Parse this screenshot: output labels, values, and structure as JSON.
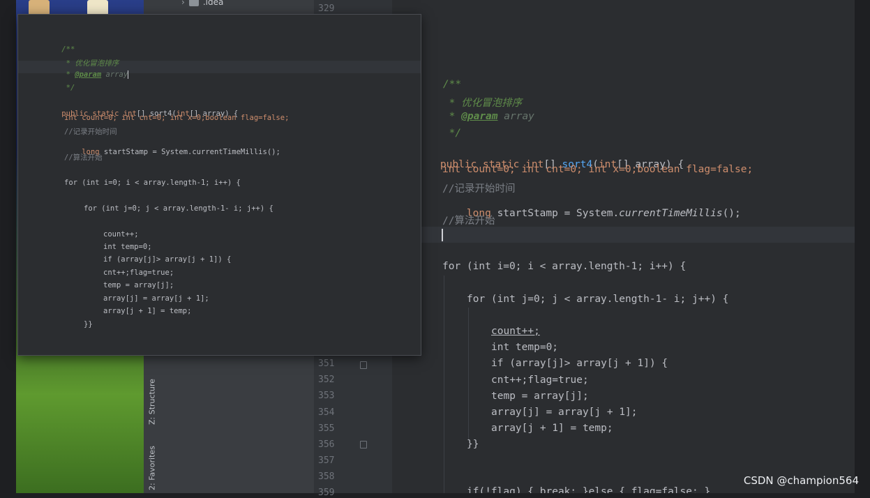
{
  "project_tree": {
    "top_item": ".idea"
  },
  "tool_tabs": {
    "structure": "Z: Structure",
    "favorites": "2: Favorites"
  },
  "line_numbers": {
    "top": "329",
    "bottom": [
      "351",
      "352",
      "353",
      "354",
      "355",
      "356",
      "357",
      "358",
      "359"
    ]
  },
  "editor_lines": {
    "doc_open": "/**",
    "doc_desc": " * 优化冒泡排序",
    "doc_tag": "@param",
    "doc_param": "array",
    "doc_close": " */",
    "sig_1": "public static ",
    "sig_2": "int",
    "sig_3": "[] ",
    "sig_4": "sort4",
    "sig_5": "(",
    "sig_6": "int",
    "sig_7": "[] array) {",
    "decl": "int count=0; int cnt=0; int x=0;boolean flag=false;",
    "c1": "//记录开始时间",
    "stamp_1": "long",
    "stamp_2": " startStamp = System.",
    "stamp_3": "currentTimeMillis",
    "stamp_4": "();",
    "c2": "//算法开始",
    "for1": "for (int i=0; i < array.length-1; i++) {",
    "for2": "for (int j=0; j < array.length-1- i; j++) {",
    "l_count": "count++;",
    "l_temp": "int temp=0;",
    "l_if": "if (array[j]> array[j + 1]) {",
    "l_cnt": "cnt++;flag=true;",
    "l_tmp": "temp = array[j];",
    "l_swap1": "array[j] = array[j + 1];",
    "l_swap2": "array[j + 1] = temp;",
    "l_close": "}}",
    "l_break": "if(!flag) { break; }else { flag=false; }"
  },
  "watermark": "CSDN @champion564"
}
